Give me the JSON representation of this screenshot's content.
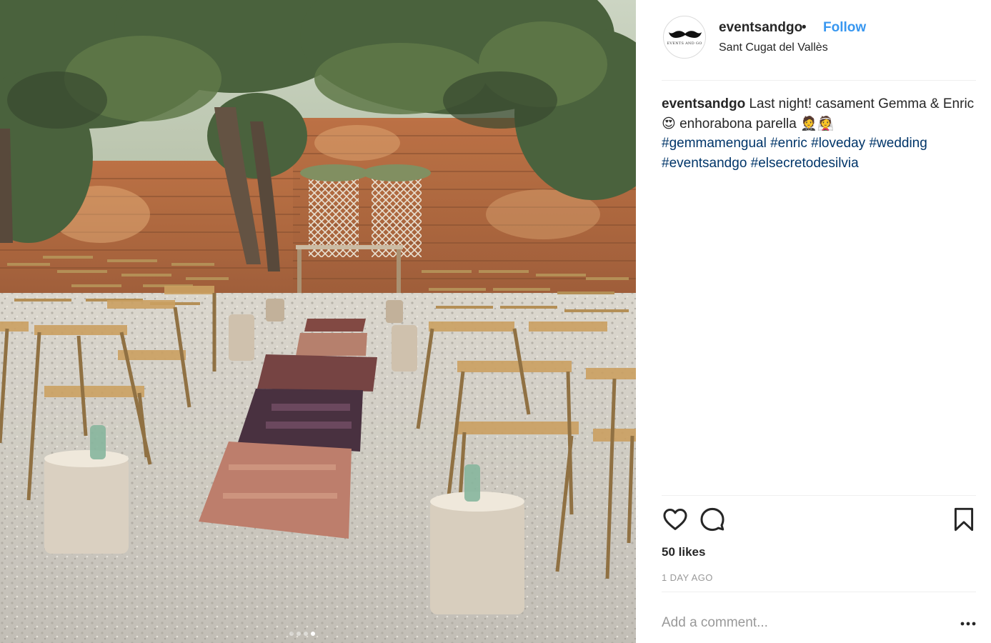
{
  "post": {
    "image_alt": "",
    "carousel": {
      "count": 4,
      "active": 4
    }
  },
  "header": {
    "avatar_text": "EVENTS AND GO",
    "username": "eventsandgo",
    "bullet": "•",
    "follow_label": "Follow",
    "location": "Sant Cugat del Vallès"
  },
  "caption": {
    "username": "eventsandgo",
    "text": " Last night! casament Gemma & Enric 😍 enhorabona parella 🤵👰",
    "hashtags": [
      "#gemmamengual",
      "#enric",
      "#loveday",
      "#wedding",
      "#eventsandgo",
      "#elsecretodesilvia"
    ]
  },
  "actions": {
    "like_icon": "heart-icon",
    "comment_icon": "comment-bubble-icon",
    "save_icon": "bookmark-icon"
  },
  "stats": {
    "likes": "50 likes",
    "time": "1 DAY AGO"
  },
  "comment": {
    "placeholder": "Add a comment...",
    "more_icon": "ellipsis-icon"
  },
  "colors": {
    "link_blue": "#3897f0",
    "hashtag": "#003569",
    "muted": "#999999",
    "divider": "#efefef"
  }
}
